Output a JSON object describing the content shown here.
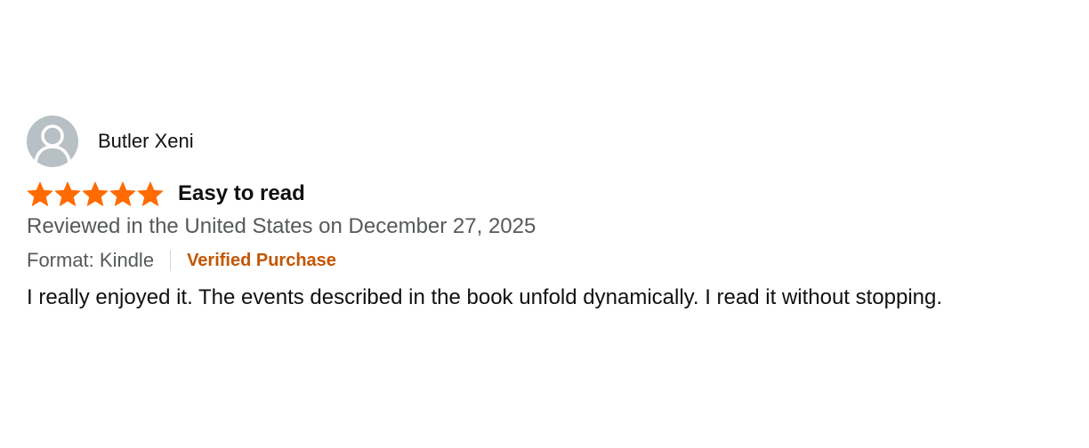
{
  "review": {
    "profile_name": "Butler Xeni",
    "avatar_icon": "person-silhouette-icon",
    "rating": 5,
    "rating_max": 5,
    "star_color": "#ff6b00",
    "title": "Easy to read",
    "date_text": "Reviewed in the United States on December 27, 2025",
    "format_text": "Format: Kindle",
    "verified_label": "Verified Purchase",
    "verified_color": "#c45500",
    "body": "I really enjoyed it. The events described in the book unfold dynamically. I read it without stopping."
  }
}
